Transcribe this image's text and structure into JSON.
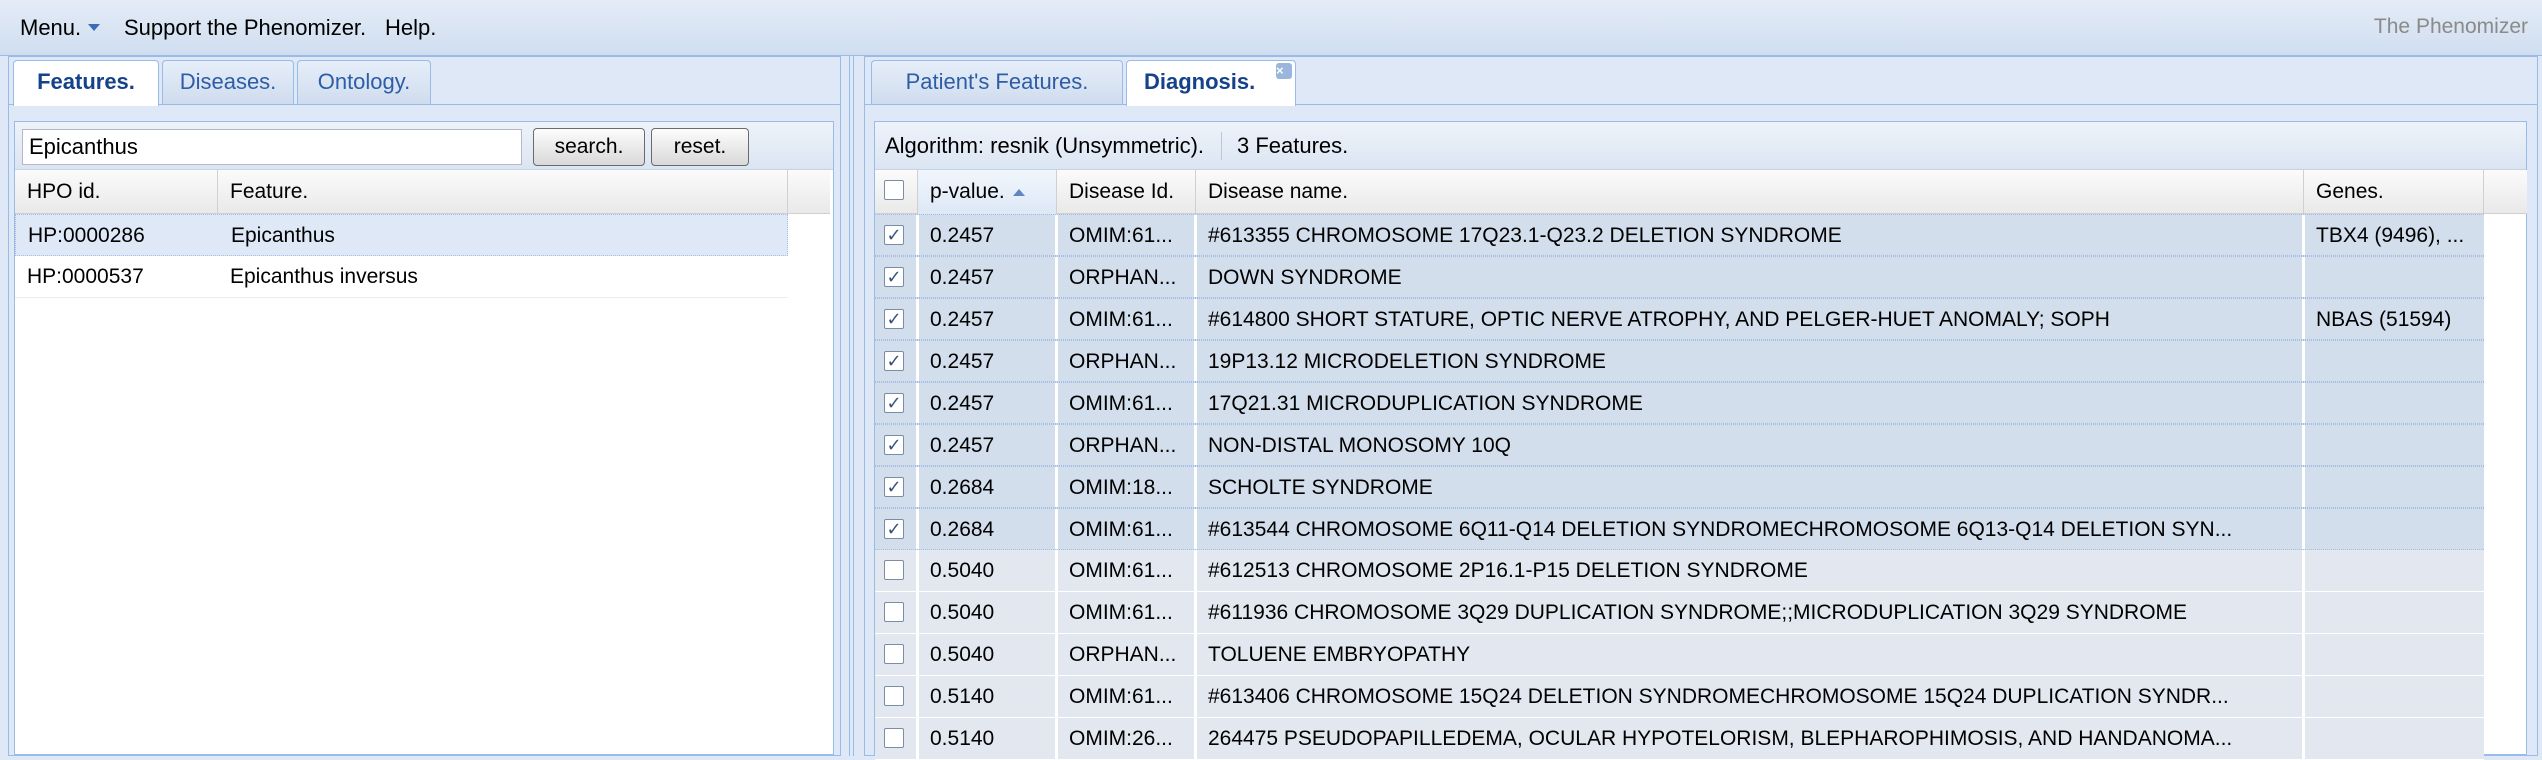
{
  "menubar": {
    "menu_label": "Menu.",
    "support_label": "Support the Phenomizer.",
    "help_label": "Help.",
    "app_title": "The Phenomizer"
  },
  "left_tabs": [
    {
      "label": "Features.",
      "active": true
    },
    {
      "label": "Diseases.",
      "active": false
    },
    {
      "label": "Ontology.",
      "active": false
    }
  ],
  "search": {
    "value": "Epicanthus",
    "search_button": "search.",
    "reset_button": "reset."
  },
  "feature_grid": {
    "columns": [
      "HPO id.",
      "Feature."
    ],
    "rows": [
      {
        "hpo_id": "HP:0000286",
        "feature": "Epicanthus",
        "selected": true
      },
      {
        "hpo_id": "HP:0000537",
        "feature": "Epicanthus inversus",
        "selected": false
      }
    ]
  },
  "right_tabs": [
    {
      "label": "Patient's Features.",
      "active": false
    },
    {
      "label": "Diagnosis.",
      "active": true,
      "closable": true
    }
  ],
  "diagnosis": {
    "algorithm": "Algorithm: resnik (Unsymmetric).",
    "feature_count": "3 Features.",
    "columns": [
      "p-value.",
      "Disease Id.",
      "Disease name.",
      "Genes."
    ],
    "rows": [
      {
        "checked": true,
        "pvalue": "0.2457",
        "disease_id": "OMIM:61...",
        "name": "#613355 CHROMOSOME 17Q23.1-Q23.2 DELETION SYNDROME",
        "genes": "TBX4 (9496), ..."
      },
      {
        "checked": true,
        "pvalue": "0.2457",
        "disease_id": "ORPHAN...",
        "name": "DOWN SYNDROME",
        "genes": ""
      },
      {
        "checked": true,
        "pvalue": "0.2457",
        "disease_id": "OMIM:61...",
        "name": "#614800 SHORT STATURE, OPTIC NERVE ATROPHY, AND PELGER-HUET ANOMALY; SOPH",
        "genes": "NBAS (51594)"
      },
      {
        "checked": true,
        "pvalue": "0.2457",
        "disease_id": "ORPHAN...",
        "name": "19P13.12 MICRODELETION SYNDROME",
        "genes": ""
      },
      {
        "checked": true,
        "pvalue": "0.2457",
        "disease_id": "OMIM:61...",
        "name": "17Q21.31 MICRODUPLICATION SYNDROME",
        "genes": ""
      },
      {
        "checked": true,
        "pvalue": "0.2457",
        "disease_id": "ORPHAN...",
        "name": "NON-DISTAL MONOSOMY 10Q",
        "genes": ""
      },
      {
        "checked": true,
        "pvalue": "0.2684",
        "disease_id": "OMIM:18...",
        "name": "SCHOLTE SYNDROME",
        "genes": ""
      },
      {
        "checked": true,
        "pvalue": "0.2684",
        "disease_id": "OMIM:61...",
        "name": "#613544 CHROMOSOME 6Q11-Q14 DELETION SYNDROMECHROMOSOME 6Q13-Q14 DELETION SYN...",
        "genes": ""
      },
      {
        "checked": false,
        "pvalue": "0.5040",
        "disease_id": "OMIM:61...",
        "name": "#612513 CHROMOSOME 2P16.1-P15 DELETION SYNDROME",
        "genes": ""
      },
      {
        "checked": false,
        "pvalue": "0.5040",
        "disease_id": "OMIM:61...",
        "name": "#611936 CHROMOSOME 3Q29 DUPLICATION SYNDROME;;MICRODUPLICATION 3Q29 SYNDROME",
        "genes": ""
      },
      {
        "checked": false,
        "pvalue": "0.5040",
        "disease_id": "ORPHAN...",
        "name": "TOLUENE EMBRYOPATHY",
        "genes": ""
      },
      {
        "checked": false,
        "pvalue": "0.5140",
        "disease_id": "OMIM:61...",
        "name": "#613406 CHROMOSOME 15Q24 DELETION SYNDROMECHROMOSOME 15Q24 DUPLICATION SYNDR...",
        "genes": ""
      },
      {
        "checked": false,
        "pvalue": "0.5140",
        "disease_id": "OMIM:26...",
        "name": "264475 PSEUDOPAPILLEDEMA, OCULAR HYPOTELORISM, BLEPHAROPHIMOSIS, AND HANDANOMA...",
        "genes": ""
      }
    ]
  },
  "icons": {
    "check": "✓",
    "close": "×"
  }
}
